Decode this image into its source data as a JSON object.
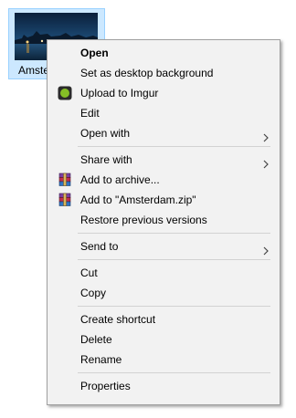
{
  "file": {
    "name_visible": "Amste",
    "name_full": "Amsterdam"
  },
  "menu": {
    "groups": [
      [
        {
          "label": "Open",
          "bold": true,
          "icon": null,
          "submenu": false
        },
        {
          "label": "Set as desktop background",
          "icon": null,
          "submenu": false
        },
        {
          "label": "Upload to Imgur",
          "icon": "imgur-icon",
          "submenu": false
        },
        {
          "label": "Edit",
          "icon": null,
          "submenu": false
        },
        {
          "label": "Open with",
          "icon": null,
          "submenu": true
        }
      ],
      [
        {
          "label": "Share with",
          "icon": null,
          "submenu": true
        },
        {
          "label": "Add to archive...",
          "icon": "winrar-icon",
          "submenu": false
        },
        {
          "label": "Add to \"Amsterdam.zip\"",
          "icon": "winrar-icon",
          "submenu": false
        },
        {
          "label": "Restore previous versions",
          "icon": null,
          "submenu": false
        }
      ],
      [
        {
          "label": "Send to",
          "icon": null,
          "submenu": true
        }
      ],
      [
        {
          "label": "Cut",
          "icon": null,
          "submenu": false
        },
        {
          "label": "Copy",
          "icon": null,
          "submenu": false
        }
      ],
      [
        {
          "label": "Create shortcut",
          "icon": null,
          "submenu": false
        },
        {
          "label": "Delete",
          "icon": null,
          "submenu": false
        },
        {
          "label": "Rename",
          "icon": null,
          "submenu": false
        }
      ],
      [
        {
          "label": "Properties",
          "icon": null,
          "submenu": false
        }
      ]
    ]
  },
  "colors": {
    "selection_bg": "#cce8ff",
    "selection_border": "#99d1ff",
    "menu_bg": "#f2f2f2",
    "imgur_green": "#85bf25"
  }
}
